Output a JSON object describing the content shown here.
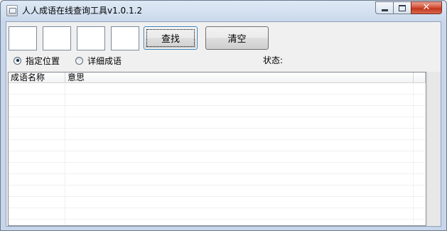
{
  "window": {
    "title": "人人成语在线查询工具v1.0.1.2",
    "caption": {
      "minimize_icon": "minimize-icon",
      "maximize_icon": "maximize-icon",
      "close_icon": "close-icon",
      "close_glyph": "✕"
    }
  },
  "search": {
    "char_inputs": [
      "",
      "",
      "",
      ""
    ],
    "find_label": "查找",
    "clear_label": "清空"
  },
  "mode": {
    "options": [
      {
        "label": "指定位置",
        "checked": true
      },
      {
        "label": "详细成语",
        "checked": false
      }
    ]
  },
  "status": {
    "label": "状态:",
    "value": ""
  },
  "list": {
    "columns": [
      "成语名称",
      "意思"
    ],
    "rows": []
  },
  "colors": {
    "close_button": "#c2361c",
    "titlebar": "#cfddee",
    "client_bg": "#f0f0f0"
  }
}
